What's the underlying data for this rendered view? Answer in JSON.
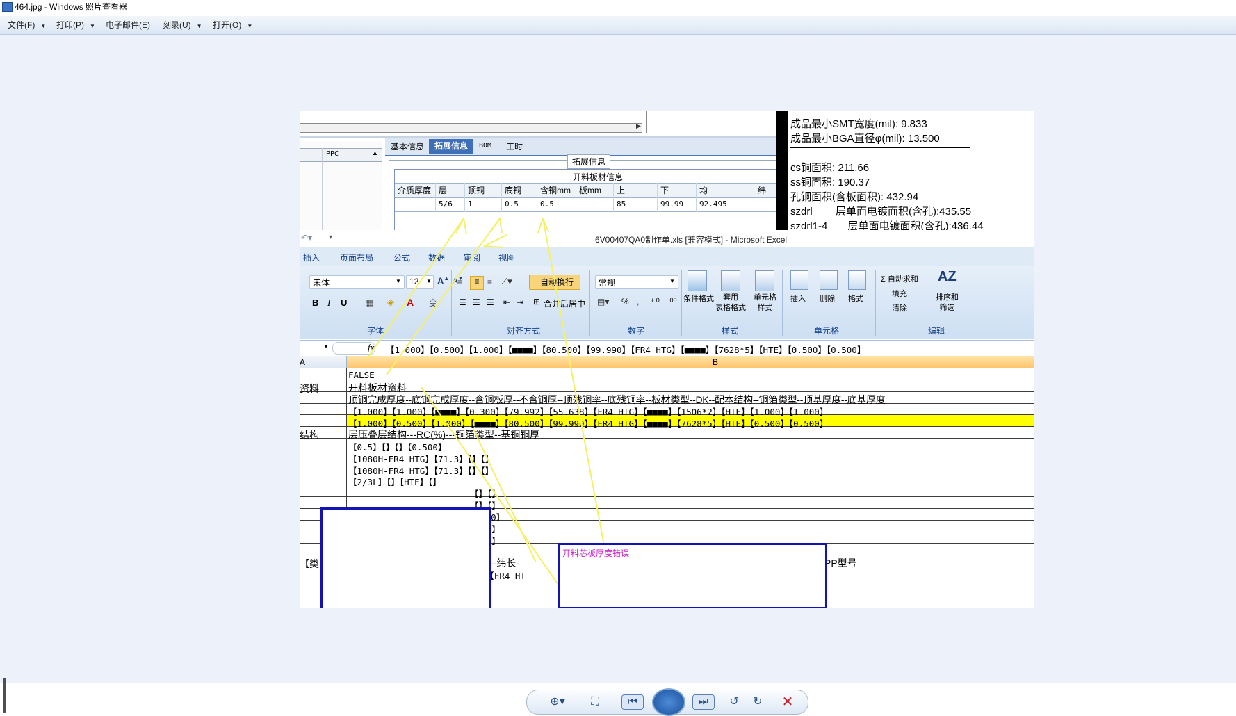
{
  "window": {
    "title": "464.jpg - Windows 照片查看器"
  },
  "menu": {
    "items": [
      "文件(F)",
      "打印(P)",
      "电子邮件(E)",
      "刻录(U)",
      "打开(O)"
    ]
  },
  "top_app": {
    "tabs": [
      "基本信息",
      "拓展信息",
      "BOM",
      "工时"
    ],
    "left_header": "PPC",
    "section_label": "拓展信息",
    "table_title": "开料板材信息",
    "columns": [
      "介质厚度",
      "层",
      "顶铜",
      "底铜",
      "含铜mm",
      "板mm",
      "上",
      "下",
      "均",
      "纬"
    ],
    "row": [
      "",
      "5/6",
      "1",
      "0.5",
      "0.5",
      "",
      "85",
      "99.99",
      "92.495",
      ""
    ]
  },
  "info_panel": {
    "lines": [
      "成品最小SMT宽度(mil): 9.833",
      "成品最小BGA直径φ(mil):  13.500",
      "cs铜面积: 211.66",
      "ss铜面积: 190.37",
      "孔铜面积(含板面积): 432.94",
      "szdrl        层单面电镀面积(含孔):435.55",
      "szdrl1-4       层单面电镀面积(含孔):436.44"
    ]
  },
  "excel": {
    "title": "6V00407QA0制作单.xls  [兼容模式] - Microsoft Excel",
    "tabs": [
      "插入",
      "页面布局",
      "公式",
      "数据",
      "审阅",
      "视图"
    ],
    "font_name": "宋体",
    "font_size": "12",
    "wrap_text": "自动换行",
    "merge_center": "合并后居中",
    "number_format": "常规",
    "style_buttons": [
      "条件格式",
      "套用\n表格格式",
      "单元格\n样式"
    ],
    "cell_buttons": [
      "插入",
      "删除",
      "格式"
    ],
    "edit_buttons": [
      "Σ 自动求和",
      "填充",
      "清除"
    ],
    "sort_button": "排序和\n筛选",
    "group_labels": [
      "字体",
      "对齐方式",
      "数字",
      "样式",
      "单元格",
      "编辑"
    ],
    "formula_bar": "【1.000】【0.500】【1.000】【■■■■】【80.500】【99.990】【FR4 HTG】【■■■■】【7628*5】【HTE】【0.500】【0.500】",
    "col_headers": [
      "A",
      "B"
    ],
    "col_a_cells": [
      "",
      "资料",
      "",
      "",
      "",
      "结构",
      "",
      "",
      "",
      "",
      "",
      "",
      "",
      "",
      "",
      "【类",
      ""
    ],
    "rows": [
      "FALSE",
      "开料板材资料",
      "顶铜完成厚度--底铜完成厚度--含铜板厚--不含铜厚--顶残铜率--底残铜率--板材类型--DK--配本结构--铜箔类型--顶基厚度--底基厚度",
      "【1.000】【1.000】【■■■■】【0.300】【79.992】【55.638】【FR4 HTG】【■■■■】【1506*2】【HTE】【1.000】【1.000】",
      "【1.000】【0.500】【1.000】【■■■■】【80.500】【99.990】【FR4 HTG】【■■■■】【7628*5】【HTE】【0.500】【0.500】",
      "层压叠层结构---RC(%)---铜箔类型--基铜铜厚",
      "【0.5】【】【】【0.500】",
      "【1080H-FR4 HTG】【71.3】【】【】",
      "【1080H-FR4 HTG】【71.3】【】【】",
      "【2/3L】【】【HTE】【】",
      "【】【】",
      "【】【】",
      "0.500】",
      "【】【】",
      "【】【】",
      "长-----纬长-",
      ".5】【FR4 HT"
    ],
    "row15_right": "PP型号"
  },
  "annotation": {
    "text": "开料芯板厚度错误"
  },
  "colors": {
    "highlight": "#ffff00",
    "annotation_border": "#1414b4",
    "annotation_text": "#c81ec8",
    "arrow": "#f5f064"
  }
}
